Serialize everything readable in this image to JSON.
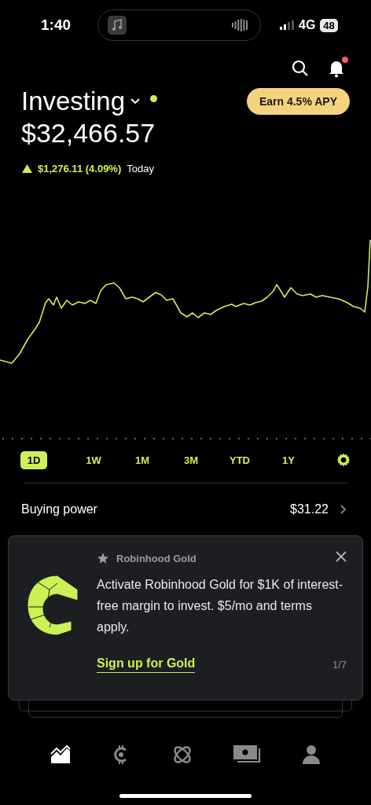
{
  "status_bar": {
    "time": "1:40",
    "network": "4G",
    "battery": "48"
  },
  "header": {
    "title": "Investing",
    "status_dot": true,
    "notification_badge": true,
    "promo_button": "Earn 4.5% APY"
  },
  "balance": "$32,466.57",
  "change": {
    "amount": "$1,276.11 (4.09%)",
    "period": "Today"
  },
  "ranges": [
    {
      "label": "1D",
      "selected": true
    },
    {
      "label": "1W",
      "selected": false
    },
    {
      "label": "1M",
      "selected": false
    },
    {
      "label": "3M",
      "selected": false
    },
    {
      "label": "YTD",
      "selected": false
    },
    {
      "label": "1Y",
      "selected": false
    }
  ],
  "buying_power": {
    "label": "Buying power",
    "value": "$31.22"
  },
  "promo_card": {
    "tag": "Robinhood Gold",
    "body": "Activate Robinhood Gold for $1K of interest-free margin to invest. $5/mo and terms apply.",
    "link": "Sign up for Gold",
    "pager": "1/7"
  },
  "nav": [
    {
      "kind": "chart",
      "selected": true
    },
    {
      "kind": "crypto",
      "selected": false
    },
    {
      "kind": "orbit",
      "selected": false
    },
    {
      "kind": "cash",
      "selected": false
    },
    {
      "kind": "account",
      "selected": false
    }
  ]
}
